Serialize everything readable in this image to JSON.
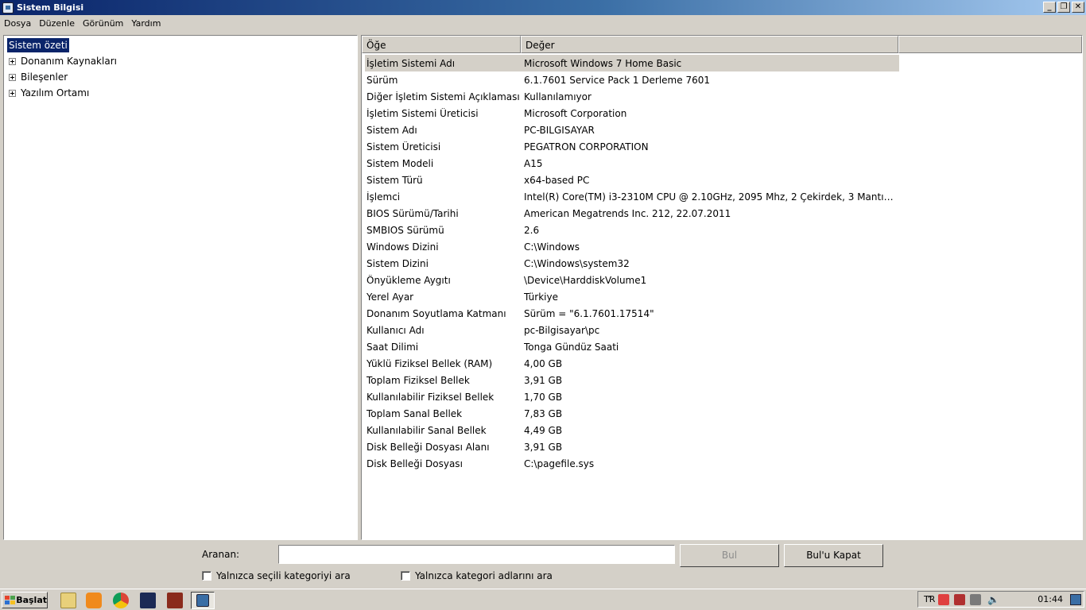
{
  "window": {
    "title": "Sistem Bilgisi"
  },
  "menu": [
    "Dosya",
    "Düzenle",
    "Görünüm",
    "Yardım"
  ],
  "tree": {
    "root": "Sistem özeti",
    "nodes": [
      "Donanım Kaynakları",
      "Bileşenler",
      "Yazılım Ortamı"
    ]
  },
  "list": {
    "headers": [
      "Öğe",
      "Değer"
    ],
    "rows": [
      [
        "İşletim Sistemi Adı",
        "Microsoft Windows 7 Home Basic"
      ],
      [
        "Sürüm",
        "6.1.7601 Service Pack 1 Derleme 7601"
      ],
      [
        "Diğer İşletim Sistemi Açıklaması",
        "Kullanılamıyor"
      ],
      [
        "İşletim Sistemi Üreticisi",
        "Microsoft Corporation"
      ],
      [
        "Sistem Adı",
        "PC-BILGISAYAR"
      ],
      [
        "Sistem Üreticisi",
        "PEGATRON CORPORATION"
      ],
      [
        "Sistem Modeli",
        "A15"
      ],
      [
        "Sistem Türü",
        "x64-based PC"
      ],
      [
        "İşlemci",
        "Intel(R) Core(TM) i3-2310M CPU @ 2.10GHz, 2095 Mhz, 2 Çekirdek, 3 Mantıks..."
      ],
      [
        "BIOS Sürümü/Tarihi",
        "American Megatrends Inc. 212, 22.07.2011"
      ],
      [
        "SMBIOS Sürümü",
        "2.6"
      ],
      [
        "Windows Dizini",
        "C:\\Windows"
      ],
      [
        "Sistem Dizini",
        "C:\\Windows\\system32"
      ],
      [
        "Önyükleme Aygıtı",
        "\\Device\\HarddiskVolume1"
      ],
      [
        "Yerel Ayar",
        "Türkiye"
      ],
      [
        "Donanım Soyutlama Katmanı",
        "Sürüm = \"6.1.7601.17514\""
      ],
      [
        "Kullanıcı Adı",
        "pc-Bilgisayar\\pc"
      ],
      [
        "Saat Dilimi",
        "Tonga Gündüz Saati"
      ],
      [
        "Yüklü Fiziksel Bellek (RAM)",
        "4,00 GB"
      ],
      [
        "Toplam Fiziksel Bellek",
        "3,91 GB"
      ],
      [
        "Kullanılabilir Fiziksel Bellek",
        "1,70 GB"
      ],
      [
        "Toplam Sanal Bellek",
        "7,83 GB"
      ],
      [
        "Kullanılabilir Sanal Bellek",
        "4,49 GB"
      ],
      [
        "Disk Belleği Dosyası Alanı",
        "3,91 GB"
      ],
      [
        "Disk Belleği Dosyası",
        "C:\\pagefile.sys"
      ]
    ]
  },
  "search": {
    "label": "Aranan:",
    "value": "",
    "find_label": "Bul",
    "close_label": "Bul'u Kapat",
    "option_selected_category": "Yalnızca seçili kategoriyi ara",
    "option_category_names": "Yalnızca kategori adlarını ara"
  },
  "taskbar": {
    "start_label": "Başlat",
    "language": "TR",
    "clock": "01:44"
  }
}
